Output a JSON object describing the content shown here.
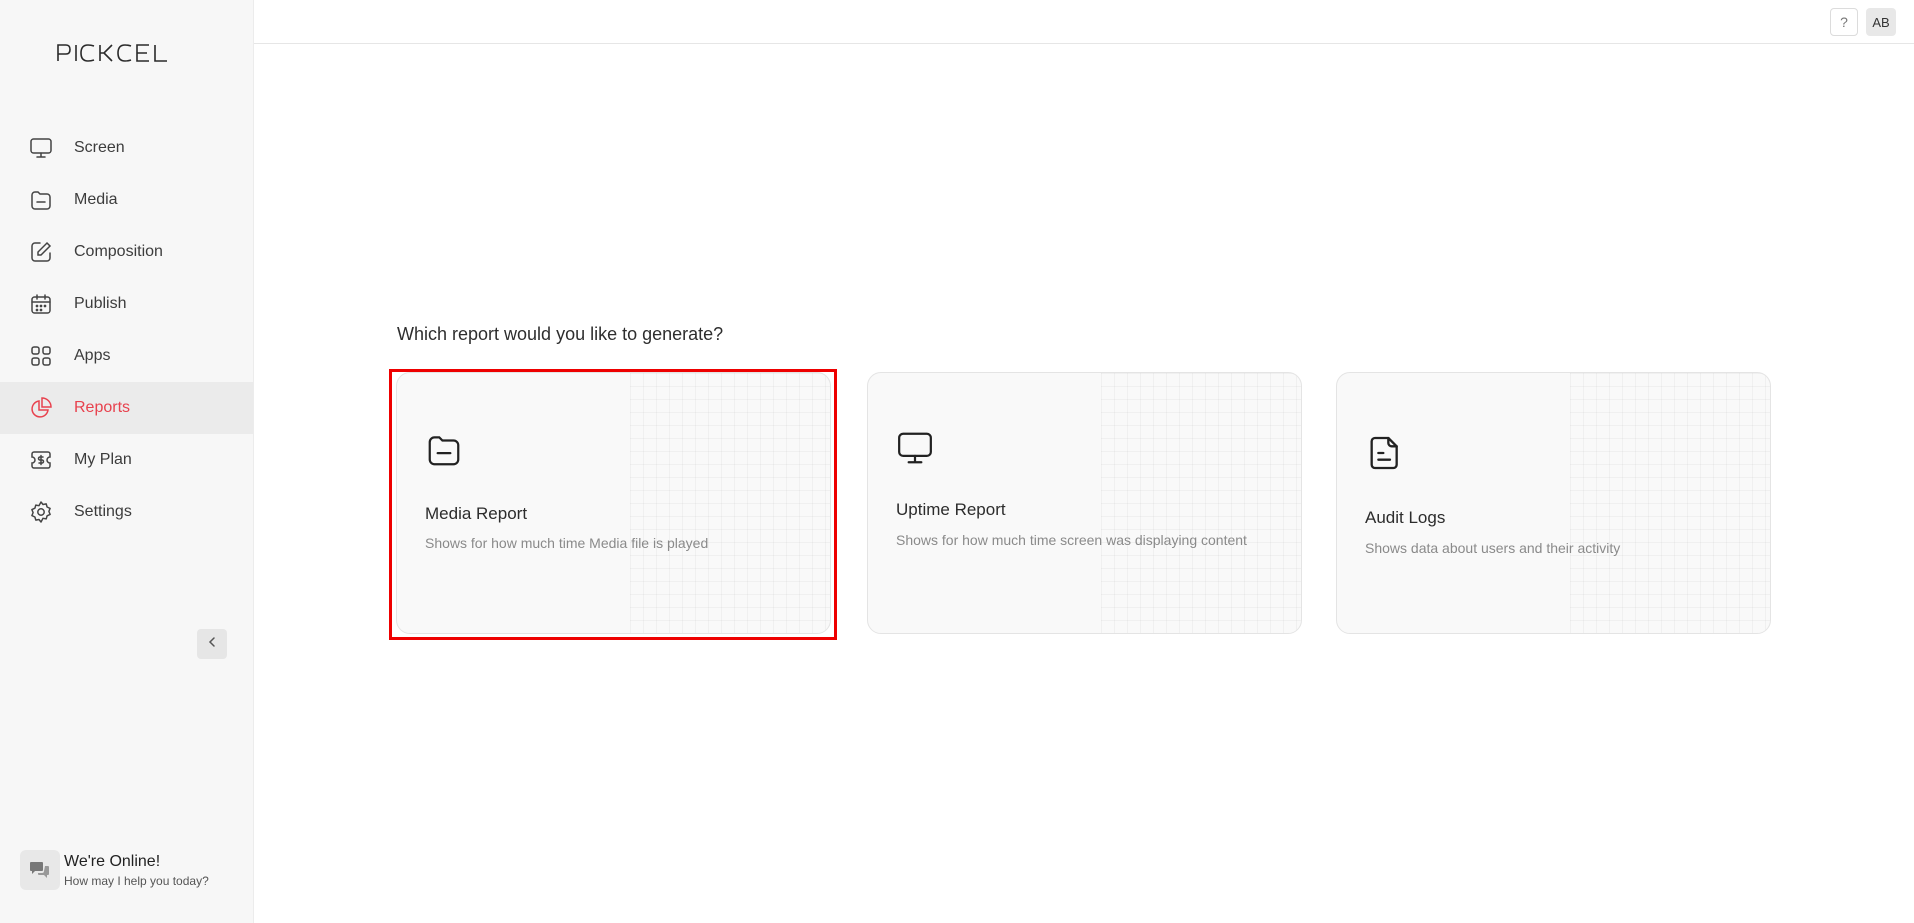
{
  "brand": {
    "logo_text": "PICKCEL"
  },
  "sidebar": {
    "items": [
      {
        "label": "Screen",
        "icon": "monitor-icon",
        "active": false
      },
      {
        "label": "Media",
        "icon": "folder-icon",
        "active": false
      },
      {
        "label": "Composition",
        "icon": "edit-icon",
        "active": false
      },
      {
        "label": "Publish",
        "icon": "calendar-icon",
        "active": false
      },
      {
        "label": "Apps",
        "icon": "apps-grid-icon",
        "active": false
      },
      {
        "label": "Reports",
        "icon": "pie-chart-icon",
        "active": true
      },
      {
        "label": "My Plan",
        "icon": "dollar-ticket-icon",
        "active": false
      },
      {
        "label": "Settings",
        "icon": "gear-icon",
        "active": false
      }
    ],
    "collapse_icon": "chevron-left-icon"
  },
  "chat": {
    "title": "We're Online!",
    "subtitle": "How may I help you today?",
    "icon": "chat-bubbles-icon"
  },
  "topbar": {
    "help_label": "?",
    "avatar_initials": "AB"
  },
  "main": {
    "question": "Which report would you like to generate?",
    "cards": [
      {
        "title": "Media Report",
        "description": "Shows for how much time Media file is played",
        "icon": "folder-icon",
        "highlighted": true
      },
      {
        "title": "Uptime Report",
        "description": "Shows for how much time screen was displaying content",
        "icon": "monitor-icon",
        "highlighted": false
      },
      {
        "title": "Audit Logs",
        "description": "Shows data about users and their activity",
        "icon": "document-icon",
        "highlighted": false
      }
    ]
  },
  "colors": {
    "accent": "#e8424e",
    "highlight_border": "#ee0000",
    "sidebar_bg": "#f7f7f7",
    "active_bg": "#ebebeb"
  }
}
